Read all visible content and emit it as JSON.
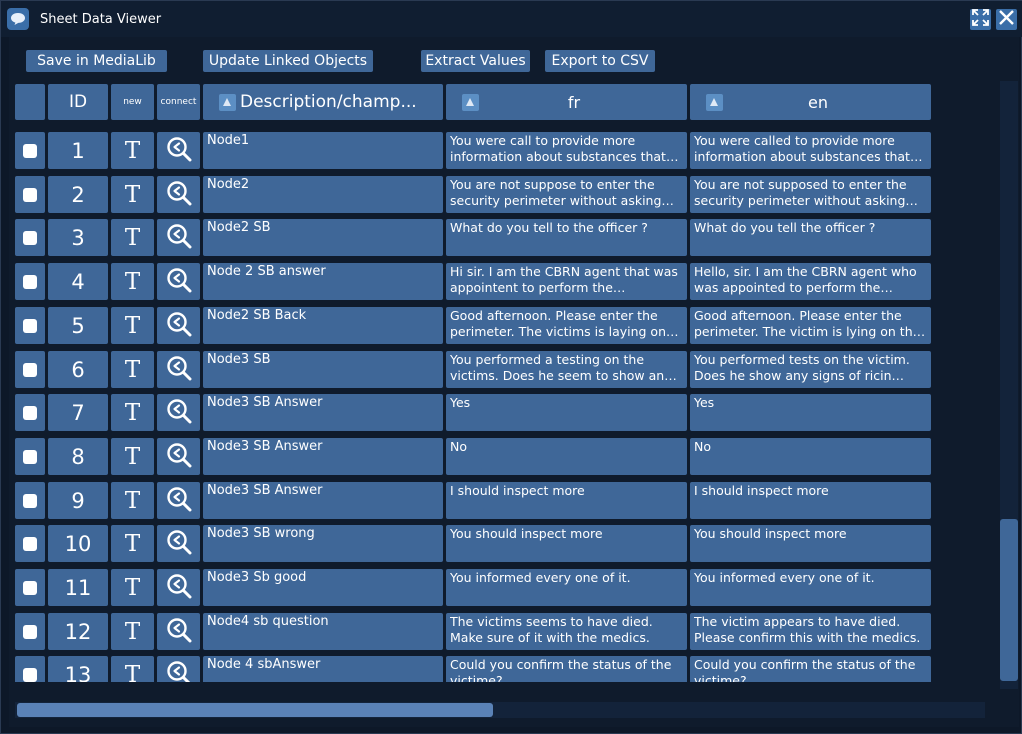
{
  "window": {
    "title": "Sheet Data Viewer"
  },
  "toolbar": {
    "save_label": "Save in MediaLib",
    "update_label": "Update Linked Objects",
    "extract_label": "Extract Values",
    "export_label": "Export to CSV"
  },
  "headers": {
    "id": "ID",
    "new": "new",
    "connect": "connect",
    "description": "Description/champ...",
    "fr": "fr",
    "en": "en"
  },
  "rows": [
    {
      "id": "1",
      "new": "T",
      "description": "Node1",
      "fr": "You were call to provide more information about substances that w...",
      "en": "You were called to provide more information about substances that w..."
    },
    {
      "id": "2",
      "new": "T",
      "description": "Node2",
      "fr": "You are not suppose to enter the security perimeter without asking pe...",
      "en": "You are not supposed to enter the security perimeter without asking for..."
    },
    {
      "id": "3",
      "new": "T",
      "description": "Node2 SB",
      "fr": "What do you tell to the officer ?",
      "en": "What do you tell the officer ?"
    },
    {
      "id": "4",
      "new": "T",
      "description": "Node 2 SB answer",
      "fr": "Hi sir. I am the CBRN agent that was appointent to perform the inspectio...",
      "en": "Hello, sir. I am the CBRN agent who was appointed to perform the inspec..."
    },
    {
      "id": "5",
      "new": "T",
      "description": "Node2 SB Back",
      "fr": "Good afternoon. Please enter the perimeter. The victims is laying on th...",
      "en": "Good afternoon. Please enter the perimeter. The victim is lying on the ..."
    },
    {
      "id": "6",
      "new": "T",
      "description": "Node3 SB",
      "fr": "You performed a testing on the victims. Does he seem to show an int...",
      "en": "You performed tests on the victim. Does he show any signs of ricin intox..."
    },
    {
      "id": "7",
      "new": "T",
      "description": "Node3 SB Answer",
      "fr": "Yes",
      "en": "Yes"
    },
    {
      "id": "8",
      "new": "T",
      "description": "Node3 SB Answer",
      "fr": "No",
      "en": "No"
    },
    {
      "id": "9",
      "new": "T",
      "description": "Node3 SB Answer",
      "fr": "I should inspect more",
      "en": "I should inspect more"
    },
    {
      "id": "10",
      "new": "T",
      "description": "Node3 SB wrong",
      "fr": "You should inspect more",
      "en": "You should inspect more"
    },
    {
      "id": "11",
      "new": "T",
      "description": "Node3 Sb good",
      "fr": "You informed every one of it.",
      "en": "You informed every one of it."
    },
    {
      "id": "12",
      "new": "T",
      "description": "Node4 sb question",
      "fr": "The victims seems to have died. Make sure of it with the medics.",
      "en": "The victim appears to have died. Please confirm this with the medics."
    },
    {
      "id": "13",
      "new": "T",
      "description": " Node 4 sbAnswer",
      "fr": "Could you confirm the status of the victime?",
      "en": "Could you confirm the status of the victime?"
    }
  ],
  "icons": {
    "app": "chat-bubble-icon",
    "maximize": "maximize-icon",
    "close": "close-icon",
    "connect": "connect-search-icon",
    "sort": "sort-up-icon"
  },
  "colors": {
    "cell": "#3f6798",
    "background": "#0f1b2c",
    "titlebar": "#101e31"
  },
  "scroll": {
    "horizontal_fraction": 0.49,
    "vertical_fraction": 0.27
  }
}
